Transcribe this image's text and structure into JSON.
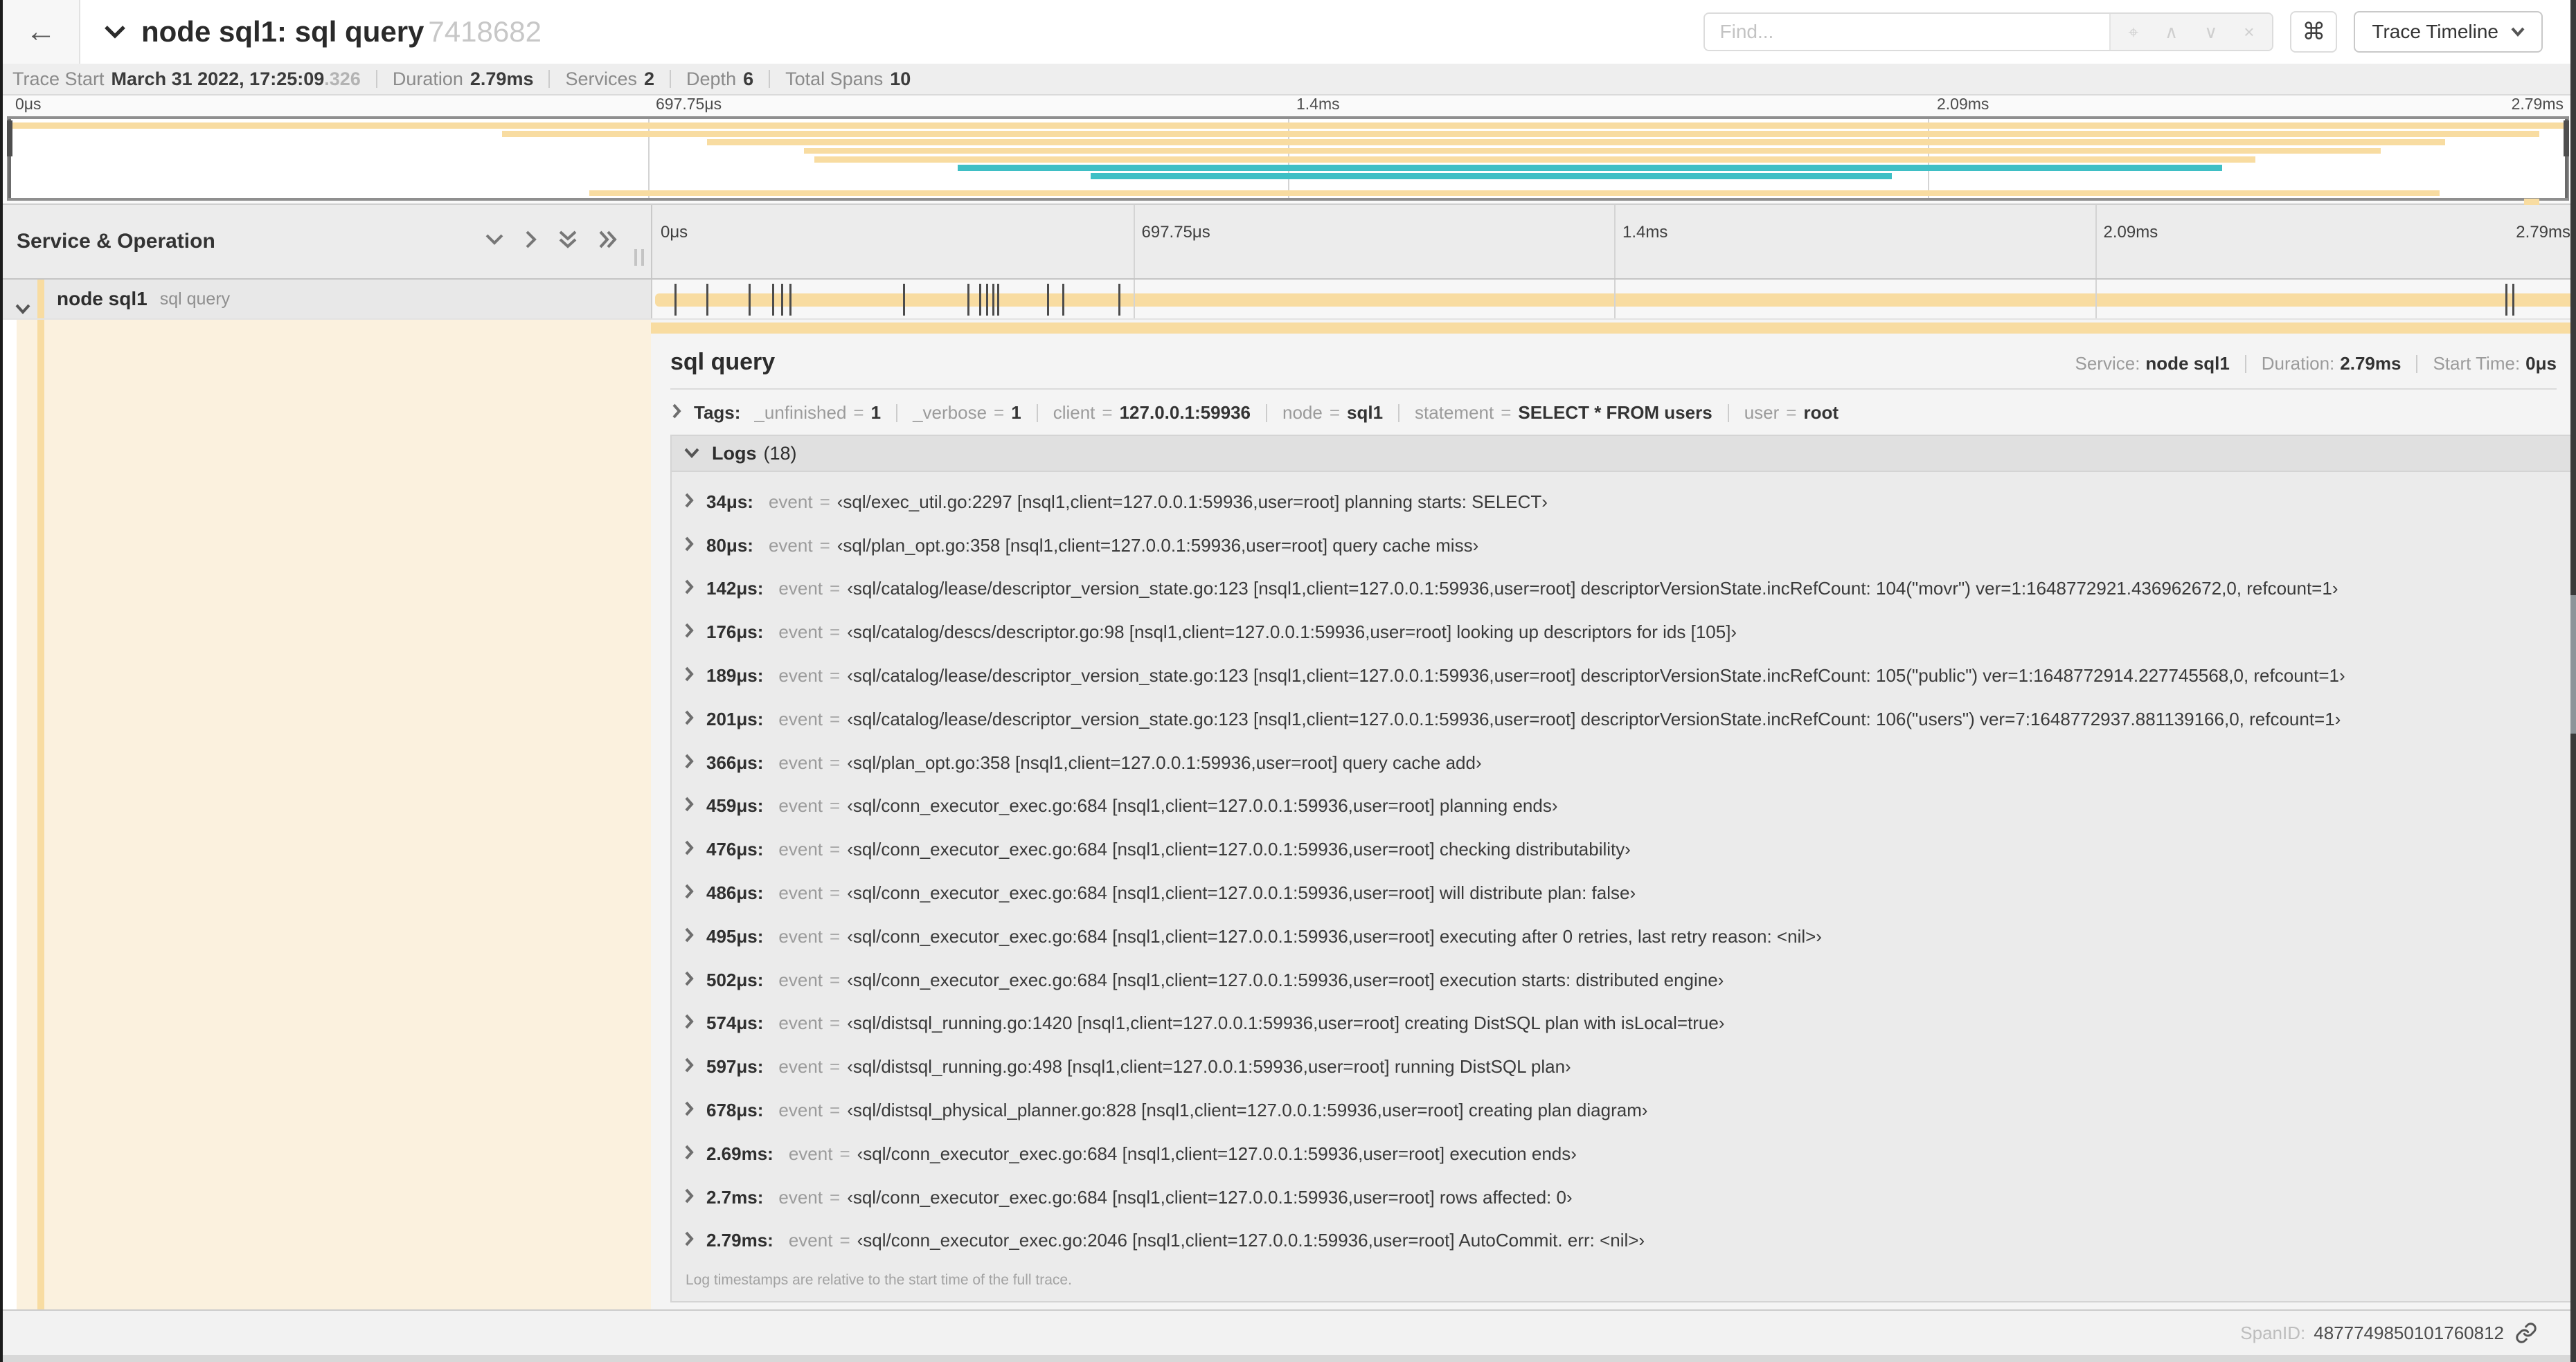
{
  "header": {
    "back_icon": "←",
    "collapse_icon": "chevron-down",
    "title": "node sql1: sql query",
    "trace_id": "7418682",
    "find_placeholder": "Find...",
    "find_tools": [
      {
        "name": "locate",
        "glyph": "⌖"
      },
      {
        "name": "prev-result",
        "glyph": "∧"
      },
      {
        "name": "next-result",
        "glyph": "∨"
      },
      {
        "name": "clear-search",
        "glyph": "×"
      }
    ],
    "shortcuts_button_glyph": "⌘",
    "view_options_label": "Trace Timeline"
  },
  "summary": {
    "items": [
      {
        "label": "Trace Start",
        "value": "March 31 2022, 17:25:09",
        "suffix": ".326"
      },
      {
        "label": "Duration",
        "value": "2.79ms"
      },
      {
        "label": "Services",
        "value": "2"
      },
      {
        "label": "Depth",
        "value": "6"
      },
      {
        "label": "Total Spans",
        "value": "10"
      }
    ]
  },
  "trace": {
    "duration_us": 2790
  },
  "timeline": {
    "left_header": "Service & Operation",
    "axis_ticks": [
      "0μs",
      "697.75μs",
      "1.4ms",
      "2.09ms",
      "2.79ms"
    ],
    "gridline_percents": [
      25,
      50,
      75
    ]
  },
  "minimap": {
    "colors": {
      "tan": "#F8DCA1",
      "teal": "#3FBFC5"
    },
    "rows": [
      {
        "start": 0,
        "end": 100,
        "color": "tan"
      },
      {
        "start": 19.3,
        "end": 98.9,
        "color": "tan"
      },
      {
        "start": 27.3,
        "end": 95.2,
        "color": "tan"
      },
      {
        "start": 31.1,
        "end": 92.7,
        "color": "tan"
      },
      {
        "start": 31.5,
        "end": 87.8,
        "color": "tan"
      },
      {
        "start": 37.1,
        "end": 86.5,
        "color": "teal"
      },
      {
        "start": 42.3,
        "end": 73.6,
        "color": "teal"
      },
      null,
      {
        "start": 22.7,
        "end": 95.0,
        "color": "tan"
      },
      {
        "start": 98.3,
        "end": 98.9,
        "color": "tan"
      }
    ]
  },
  "span": {
    "service": "node sql1",
    "operation": "sql query"
  },
  "detail": {
    "title": "sql query",
    "meta": [
      {
        "label": "Service:",
        "value": "node sql1"
      },
      {
        "label": "Duration:",
        "value": "2.79ms"
      },
      {
        "label": "Start Time:",
        "value": "0μs"
      }
    ],
    "tags": {
      "label": "Tags:",
      "equals": "=",
      "items": [
        {
          "key": "_unfinished",
          "value": "1"
        },
        {
          "key": "_verbose",
          "value": "1"
        },
        {
          "key": "client",
          "value": "127.0.0.1:59936"
        },
        {
          "key": "node",
          "value": "sql1"
        },
        {
          "key": "statement",
          "value": "SELECT * FROM users"
        },
        {
          "key": "user",
          "value": "root"
        }
      ]
    },
    "logs": {
      "label": "Logs",
      "count": "(18)",
      "entry_key": "event",
      "equals": "=",
      "entries": [
        {
          "time": "34μs",
          "time_us": 34,
          "value": "‹sql/exec_util.go:2297 [nsql1,client=127.0.0.1:59936,user=root] planning starts: SELECT›"
        },
        {
          "time": "80μs",
          "time_us": 80,
          "value": "‹sql/plan_opt.go:358 [nsql1,client=127.0.0.1:59936,user=root] query cache miss›"
        },
        {
          "time": "142μs",
          "time_us": 142,
          "value": "‹sql/catalog/lease/descriptor_version_state.go:123 [nsql1,client=127.0.0.1:59936,user=root] descriptorVersionState.incRefCount: 104(\"movr\") ver=1:1648772921.436962672,0, refcount=1›"
        },
        {
          "time": "176μs",
          "time_us": 176,
          "value": "‹sql/catalog/descs/descriptor.go:98 [nsql1,client=127.0.0.1:59936,user=root] looking up descriptors for ids [105]›"
        },
        {
          "time": "189μs",
          "time_us": 189,
          "value": "‹sql/catalog/lease/descriptor_version_state.go:123 [nsql1,client=127.0.0.1:59936,user=root] descriptorVersionState.incRefCount: 105(\"public\") ver=1:1648772914.227745568,0, refcount=1›"
        },
        {
          "time": "201μs",
          "time_us": 201,
          "value": "‹sql/catalog/lease/descriptor_version_state.go:123 [nsql1,client=127.0.0.1:59936,user=root] descriptorVersionState.incRefCount: 106(\"users\") ver=7:1648772937.881139166,0, refcount=1›"
        },
        {
          "time": "366μs",
          "time_us": 366,
          "value": "‹sql/plan_opt.go:358 [nsql1,client=127.0.0.1:59936,user=root] query cache add›"
        },
        {
          "time": "459μs",
          "time_us": 459,
          "value": "‹sql/conn_executor_exec.go:684 [nsql1,client=127.0.0.1:59936,user=root] planning ends›"
        },
        {
          "time": "476μs",
          "time_us": 476,
          "value": "‹sql/conn_executor_exec.go:684 [nsql1,client=127.0.0.1:59936,user=root] checking distributability›"
        },
        {
          "time": "486μs",
          "time_us": 486,
          "value": "‹sql/conn_executor_exec.go:684 [nsql1,client=127.0.0.1:59936,user=root] will distribute plan: false›"
        },
        {
          "time": "495μs",
          "time_us": 495,
          "value": "‹sql/conn_executor_exec.go:684 [nsql1,client=127.0.0.1:59936,user=root] executing after 0 retries, last retry reason: <nil>›"
        },
        {
          "time": "502μs",
          "time_us": 502,
          "value": "‹sql/conn_executor_exec.go:684 [nsql1,client=127.0.0.1:59936,user=root] execution starts: distributed engine›"
        },
        {
          "time": "574μs",
          "time_us": 574,
          "value": "‹sql/distsql_running.go:1420 [nsql1,client=127.0.0.1:59936,user=root] creating DistSQL plan with isLocal=true›"
        },
        {
          "time": "597μs",
          "time_us": 597,
          "value": "‹sql/distsql_running.go:498 [nsql1,client=127.0.0.1:59936,user=root] running DistSQL plan›"
        },
        {
          "time": "678μs",
          "time_us": 678,
          "value": "‹sql/distsql_physical_planner.go:828 [nsql1,client=127.0.0.1:59936,user=root] creating plan diagram›"
        },
        {
          "time": "2.69ms",
          "time_us": 2690,
          "value": "‹sql/conn_executor_exec.go:684 [nsql1,client=127.0.0.1:59936,user=root] execution ends›"
        },
        {
          "time": "2.7ms",
          "time_us": 2700,
          "value": "‹sql/conn_executor_exec.go:684 [nsql1,client=127.0.0.1:59936,user=root] rows affected: 0›"
        },
        {
          "time": "2.79ms",
          "time_us": 2790,
          "value": "‹sql/conn_executor_exec.go:2046 [nsql1,client=127.0.0.1:59936,user=root] AutoCommit. err: <nil>›"
        }
      ],
      "footnote": "Log timestamps are relative to the start time of the full trace."
    },
    "span_id_label": "SpanID:",
    "span_id": "4877749850101760812"
  }
}
